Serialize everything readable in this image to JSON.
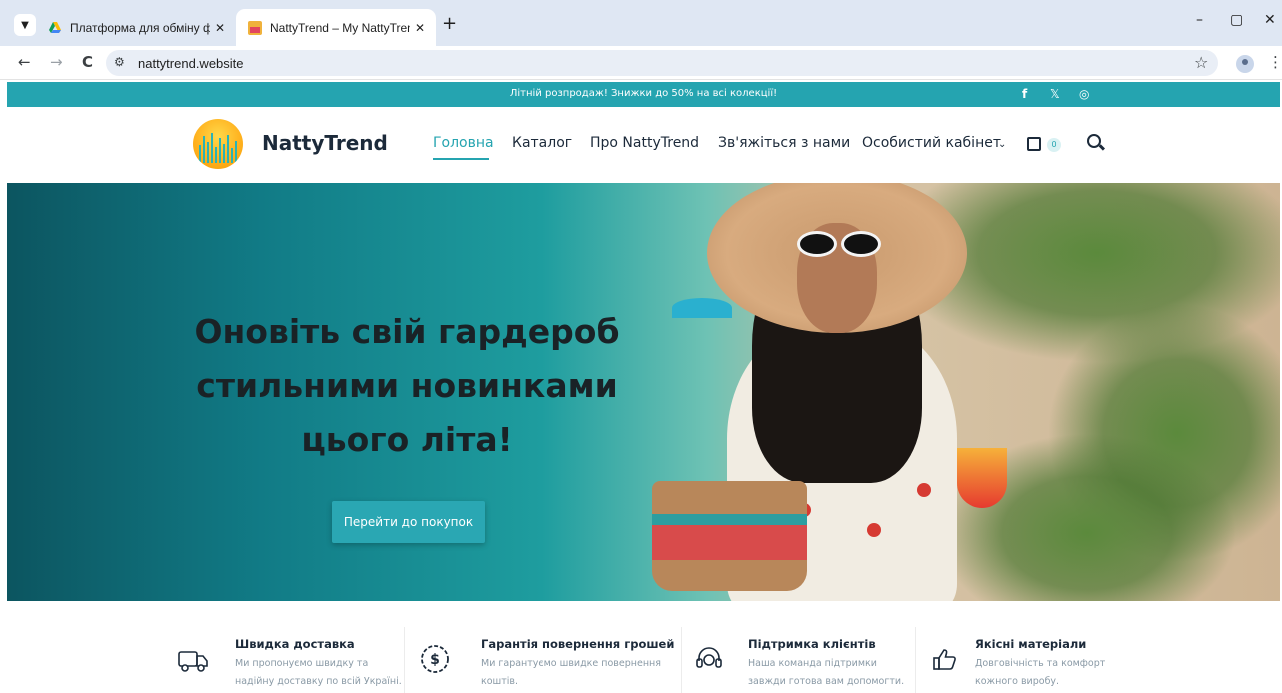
{
  "browser": {
    "tabs": [
      {
        "title": "Платформа для обміну файла…",
        "close": "✕"
      },
      {
        "title": "NattyTrend – My NattyTrend W…",
        "close": "✕",
        "active": true
      }
    ],
    "new_tab": "+",
    "window_controls": {
      "minimize": "–",
      "restore": "▢",
      "close": "✕"
    },
    "url": "nattytrend.website",
    "nav": {
      "back": "←",
      "forward": "→",
      "reload": "C"
    }
  },
  "announcement": {
    "text": "Літній розпродаж! Знижки до 50% на всі колекції!",
    "social": [
      "facebook-icon",
      "x-icon",
      "instagram-icon"
    ]
  },
  "header": {
    "logo_text": "NattyTrend",
    "nav": [
      {
        "label": "Головна",
        "active": true
      },
      {
        "label": "Каталог"
      },
      {
        "label": "Про NattyTrend"
      },
      {
        "label": "Зв'яжіться з нами"
      },
      {
        "label": "Особистий кабінет"
      }
    ],
    "cart_count": "0",
    "accent_color": "#25a4b0"
  },
  "hero": {
    "title_lines": [
      "Оновіть свій гардероб",
      "стильними новинками",
      "цього літа!"
    ],
    "cta": "Перейти до покупок"
  },
  "features": [
    {
      "icon": "truck-icon",
      "title": "Швидка доставка",
      "desc": "Ми пропонуємо швидку та надійну доставку по всій Україні."
    },
    {
      "icon": "money-back-icon",
      "title": "Гарантія повернення грошей",
      "desc": "Ми гарантуємо швидке повернення коштів."
    },
    {
      "icon": "support-headset-icon",
      "title": "Підтримка клієнтів",
      "desc": "Наша команда підтримки завжди готова вам допомогти."
    },
    {
      "icon": "thumbs-up-icon",
      "title": "Якісні матеріали",
      "desc": "Довговічність та комфорт кожного виробу."
    }
  ]
}
